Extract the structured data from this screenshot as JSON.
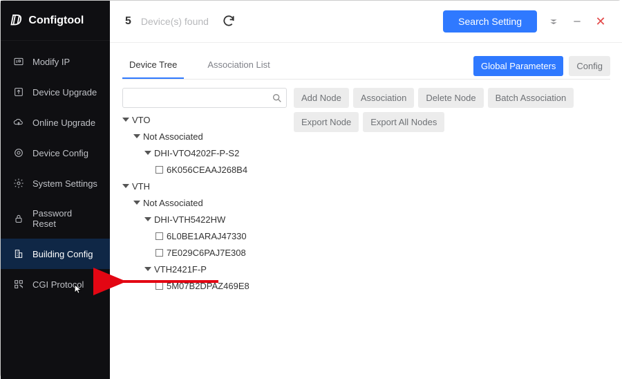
{
  "brand": {
    "name": "Configtool"
  },
  "nav": {
    "items": [
      {
        "label": "Modify IP",
        "icon": "ip"
      },
      {
        "label": "Device Upgrade",
        "icon": "upgrade"
      },
      {
        "label": "Online Upgrade",
        "icon": "cloud"
      },
      {
        "label": "Device Config",
        "icon": "target"
      },
      {
        "label": "System Settings",
        "icon": "gear"
      },
      {
        "label": "Password Reset",
        "icon": "lock"
      },
      {
        "label": "Building Config",
        "icon": "building",
        "active": true
      },
      {
        "label": "CGI Protocol",
        "icon": "qr"
      }
    ]
  },
  "topbar": {
    "count": "5",
    "found_label": "Device(s) found",
    "search_setting": "Search Setting"
  },
  "tabs": {
    "device_tree": "Device Tree",
    "association_list": "Association List",
    "global_parameters": "Global Parameters",
    "config": "Config"
  },
  "actions": {
    "add_node": "Add Node",
    "association": "Association",
    "delete_node": "Delete Node",
    "batch_association": "Batch Association",
    "export_node": "Export Node",
    "export_all_nodes": "Export All Nodes"
  },
  "search": {
    "placeholder": ""
  },
  "tree": {
    "vto": {
      "label": "VTO",
      "not_associated": "Not Associated",
      "model": "DHI-VTO4202F-P-S2",
      "serials": [
        "6K056CEAAJ268B4"
      ]
    },
    "vth": {
      "label": "VTH",
      "not_associated": "Not Associated",
      "model1": "DHI-VTH5422HW",
      "model1_serials": [
        "6L0BE1ARAJ47330",
        "7E029C6PAJ7E308"
      ],
      "model2": "VTH2421F-P",
      "model2_serials": [
        "5M07B2DPAZ469E8"
      ]
    }
  }
}
